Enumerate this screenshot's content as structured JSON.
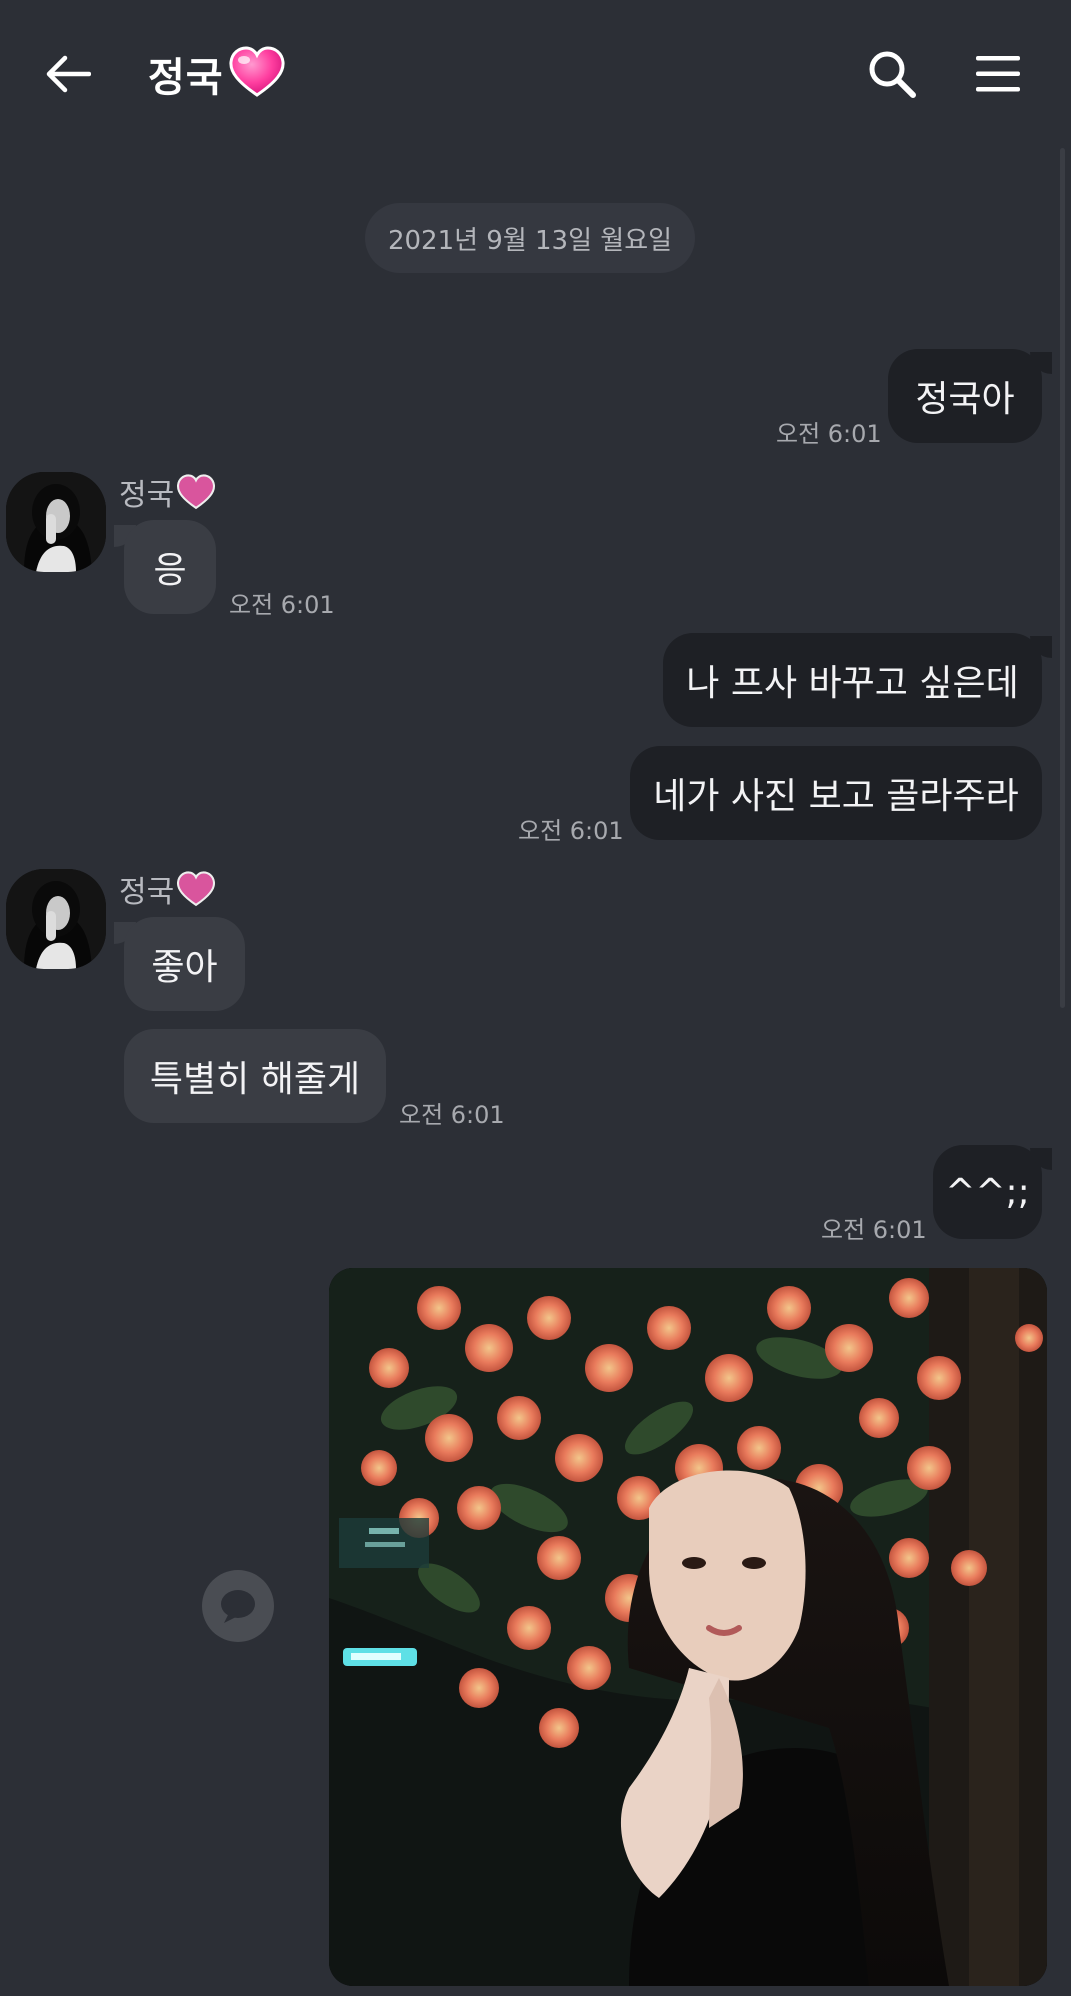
{
  "header": {
    "title": "정국",
    "back_icon": "arrow-left-icon",
    "search_icon": "search-icon",
    "menu_icon": "hamburger-menu-icon"
  },
  "date_divider": "2021년 9월 13일 월요일",
  "messages": {
    "m1": {
      "text": "정국아",
      "time": "오전 6:01"
    },
    "them1": {
      "sender": "정국",
      "text": "응",
      "time": "오전 6:01"
    },
    "m2": {
      "text": "나 프사 바꾸고 싶은데"
    },
    "m3": {
      "text": "네가 사진 보고 골라주라",
      "time": "오전 6:01"
    },
    "them2": {
      "sender": "정국",
      "text1": "좋아",
      "text2": "특별히 해줄게",
      "time": "오전 6:01"
    },
    "m4": {
      "text": "^^;;",
      "time": "오전 6:01"
    }
  },
  "colors": {
    "background": "#2c2f36",
    "my_bubble": "#1e2025",
    "their_bubble": "#3a3d44",
    "heart": "#ff3fa0"
  }
}
